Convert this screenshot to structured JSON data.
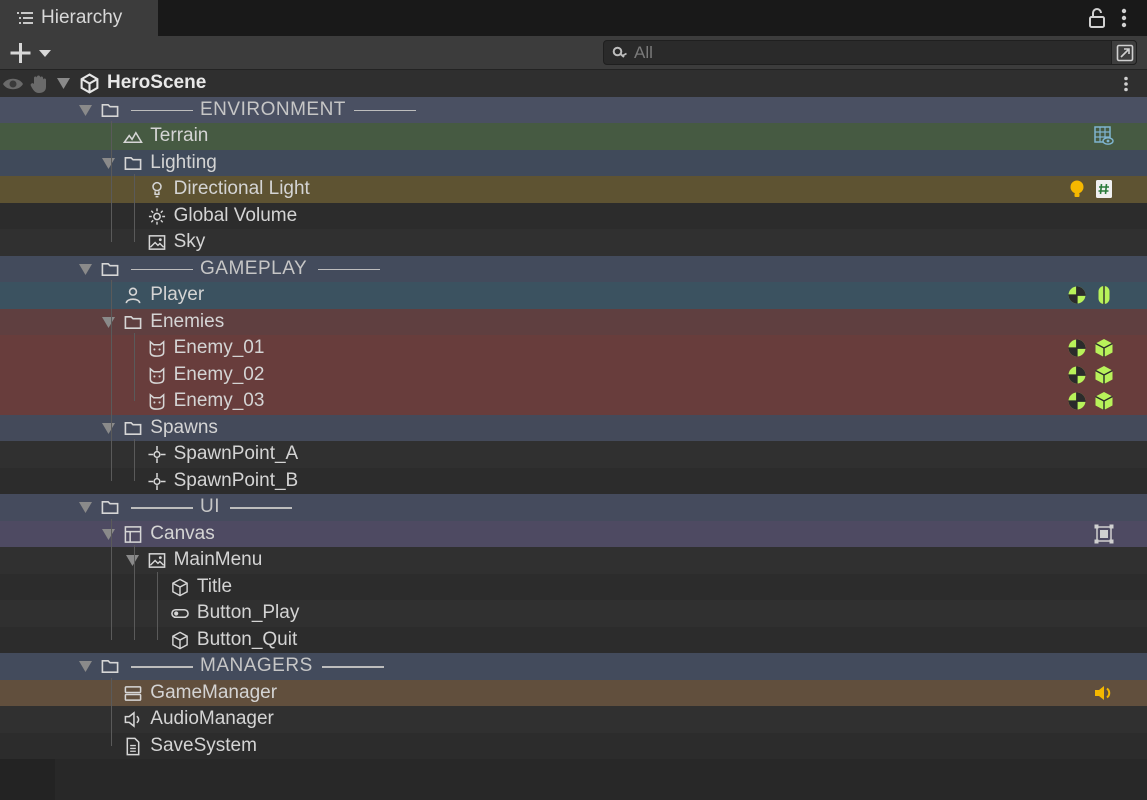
{
  "tab": {
    "title": "Hierarchy"
  },
  "search": {
    "placeholder": "All",
    "value": ""
  },
  "scene": {
    "name": "HeroScene"
  },
  "colors": {
    "environment_header": "#4a5062",
    "terrain": "#465a42",
    "lighting": "#404a5a",
    "directional_light": "#5e5332",
    "gameplay_header": "#434b5c",
    "player": "#3b5260",
    "enemies": "#5f3f40",
    "enemy_rows": "#683d3c",
    "spawns": "#444a5a",
    "ui_header": "#454b5d",
    "canvas": "#4e4a62",
    "managers_header": "#434b5c",
    "game_manager": "#614f3d",
    "badge_green": "#b8f25a",
    "badge_yellow": "#f5b800",
    "badge_blue": "#7fb5d0"
  },
  "rows": [
    {
      "kind": "scene",
      "label": "HeroScene",
      "icon": "unity-scene-icon"
    },
    {
      "kind": "header",
      "label": "ENVIRONMENT",
      "icon": "folder-icon"
    },
    {
      "kind": "item",
      "label": "Terrain",
      "icon": "terrain-icon",
      "badges": [
        "terrain-visibility-icon"
      ]
    },
    {
      "kind": "folder",
      "label": "Lighting",
      "icon": "folder-icon"
    },
    {
      "kind": "item",
      "label": "Directional Light",
      "icon": "light-icon",
      "badges": [
        "bulb-icon",
        "script-icon"
      ]
    },
    {
      "kind": "item",
      "label": "Global Volume",
      "icon": "volume-icon"
    },
    {
      "kind": "item",
      "label": "Sky",
      "icon": "image-icon"
    },
    {
      "kind": "header",
      "label": "GAMEPLAY",
      "icon": "folder-icon"
    },
    {
      "kind": "item",
      "label": "Player",
      "icon": "person-icon",
      "badges": [
        "rigidbody-icon",
        "capsule-collider-icon"
      ]
    },
    {
      "kind": "folder",
      "label": "Enemies",
      "icon": "folder-icon"
    },
    {
      "kind": "item",
      "label": "Enemy_01",
      "icon": "enemy-icon",
      "badges": [
        "rigidbody-icon",
        "box-collider-icon"
      ]
    },
    {
      "kind": "item",
      "label": "Enemy_02",
      "icon": "enemy-icon",
      "badges": [
        "rigidbody-icon",
        "box-collider-icon"
      ]
    },
    {
      "kind": "item",
      "label": "Enemy_03",
      "icon": "enemy-icon",
      "badges": [
        "rigidbody-icon",
        "box-collider-icon"
      ]
    },
    {
      "kind": "folder",
      "label": "Spawns",
      "icon": "folder-icon"
    },
    {
      "kind": "item",
      "label": "SpawnPoint_A",
      "icon": "spawn-point-icon"
    },
    {
      "kind": "item",
      "label": "SpawnPoint_B",
      "icon": "spawn-point-icon"
    },
    {
      "kind": "header",
      "label": "UI",
      "icon": "folder-icon"
    },
    {
      "kind": "folder",
      "label": "Canvas",
      "icon": "canvas-icon",
      "badges": [
        "rect-transform-icon"
      ]
    },
    {
      "kind": "folder",
      "label": "MainMenu",
      "icon": "image-icon"
    },
    {
      "kind": "item",
      "label": "Title",
      "icon": "cube-outline-icon"
    },
    {
      "kind": "item",
      "label": "Button_Play",
      "icon": "toggle-icon"
    },
    {
      "kind": "item",
      "label": "Button_Quit",
      "icon": "cube-outline-icon"
    },
    {
      "kind": "header",
      "label": "MANAGERS",
      "icon": "folder-icon"
    },
    {
      "kind": "item",
      "label": "GameManager",
      "icon": "server-icon",
      "badges": [
        "audio-source-icon"
      ]
    },
    {
      "kind": "item",
      "label": "AudioManager",
      "icon": "speaker-icon"
    },
    {
      "kind": "item",
      "label": "SaveSystem",
      "icon": "document-icon"
    }
  ]
}
